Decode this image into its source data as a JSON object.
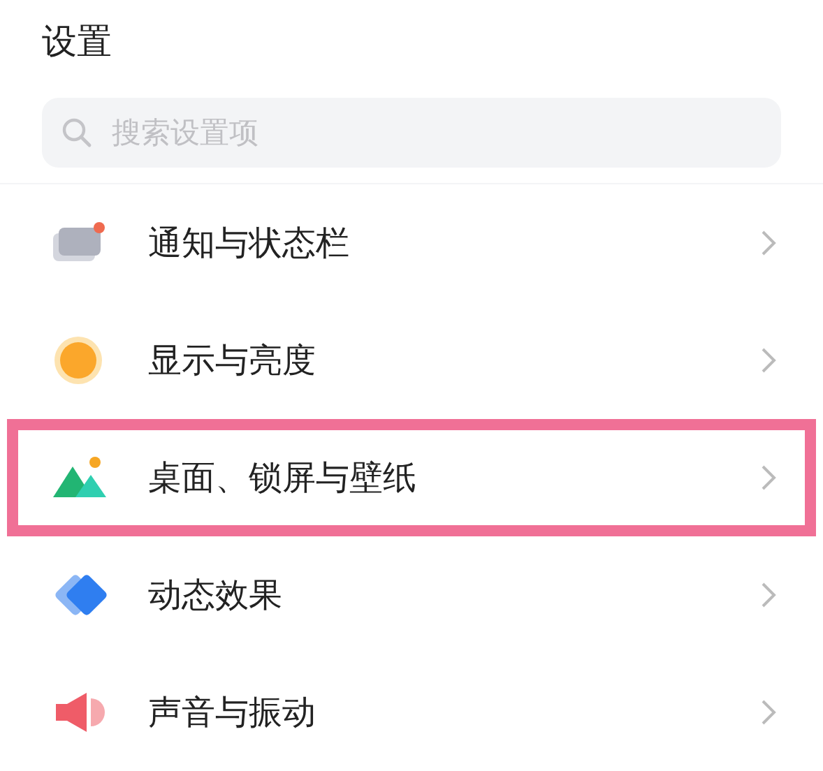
{
  "title": "设置",
  "search": {
    "placeholder": "搜索设置项"
  },
  "items": [
    {
      "label": "通知与状态栏",
      "highlighted": false
    },
    {
      "label": "显示与亮度",
      "highlighted": false
    },
    {
      "label": "桌面、锁屏与壁纸",
      "highlighted": true
    },
    {
      "label": "动态效果",
      "highlighted": false
    },
    {
      "label": "声音与振动",
      "highlighted": false
    }
  ]
}
